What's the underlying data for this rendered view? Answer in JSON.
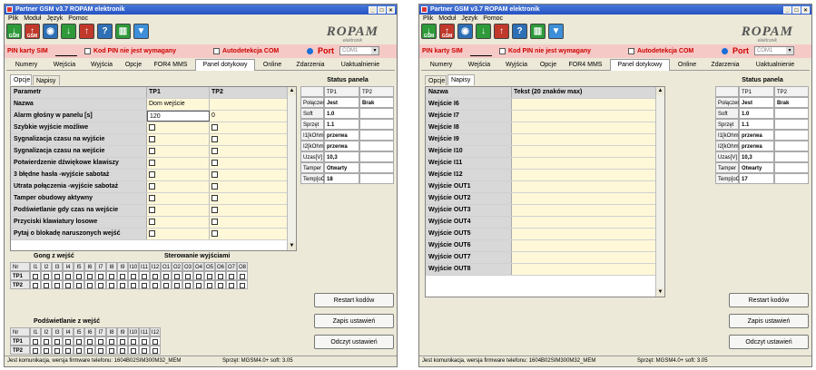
{
  "window_title": "Partner GSM v3.7 ROPAM elektronik",
  "menu": [
    "Plik",
    "Moduł",
    "Język",
    "Pomoc"
  ],
  "toolbar": {
    "buttons": [
      {
        "icon": "gsm-read-icon",
        "glyph": "↓",
        "label": "GSM",
        "color": "#2e9a3a"
      },
      {
        "icon": "gsm-write-icon",
        "glyph": "↑",
        "label": "GSM",
        "color": "#c0392b"
      },
      {
        "icon": "eye-settings-icon",
        "glyph": "◉",
        "label": "",
        "color": "#2e6fb5"
      },
      {
        "icon": "download-icon",
        "glyph": "↓",
        "label": "",
        "color": "#2e9a3a"
      },
      {
        "icon": "upload-icon",
        "glyph": "↑",
        "label": "",
        "color": "#c0392b"
      },
      {
        "icon": "help-icon",
        "glyph": "?",
        "label": "",
        "color": "#2e6fb5"
      },
      {
        "icon": "sim-card-icon",
        "glyph": "▥",
        "label": "",
        "color": "#2e9a3a"
      },
      {
        "icon": "filter-icon",
        "glyph": "▼",
        "label": "",
        "color": "#3c8fd8"
      }
    ]
  },
  "logo": {
    "text": "ROPAM",
    "sub": "elektronik"
  },
  "pin_bar": {
    "pin_label": "PIN karty SIM",
    "kod_pin_label": "Kod PIN nie jest wymagany",
    "autodetect_label": "Autodetekcja COM",
    "port_label": "Port",
    "port_value": "COM1"
  },
  "tabs": [
    "Numery",
    "Wejścia",
    "Wyjścia",
    "Opcje",
    "FOR4 MMS",
    "Panel dotykowy",
    "Online",
    "Zdarzenia",
    "Uaktualnienie"
  ],
  "selected_tab": "Panel dotykowy",
  "left_window": {
    "subtabs": [
      "Opcje",
      "Napisy"
    ],
    "grid_header": {
      "param": "Parametr",
      "tp1": "TP1",
      "tp2": "TP2"
    },
    "rows": [
      {
        "param": "Nazwa",
        "tp1": "Dom wejście",
        "tp2": ""
      },
      {
        "param": "Alarm głośny w panelu [s]",
        "tp1": "120",
        "tp2": "0"
      },
      {
        "param": "Szybkie wyjście możliwe",
        "tp1": "",
        "tp2": ""
      },
      {
        "param": "Sygnalizacja czasu na wyjście",
        "tp1": "",
        "tp2": ""
      },
      {
        "param": "Sygnalizacja czasu na wejście",
        "tp1": "",
        "tp2": ""
      },
      {
        "param": "Potwierdzenie dźwiękowe klawiszy",
        "tp1": "",
        "tp2": ""
      },
      {
        "param": "3 błędne hasła -wyjście sabotaż",
        "tp1": "",
        "tp2": ""
      },
      {
        "param": "Utrata połączenia -wyjście sabotaż",
        "tp1": "",
        "tp2": ""
      },
      {
        "param": "Tamper obudowy aktywny",
        "tp1": "",
        "tp2": ""
      },
      {
        "param": "Podświetlanie gdy czas na wejście",
        "tp1": "",
        "tp2": ""
      },
      {
        "param": "Przyciski klawiatury losowe",
        "tp1": "",
        "tp2": ""
      },
      {
        "param": "Pytaj o blokadę naruszonych wejść",
        "tp1": "",
        "tp2": ""
      }
    ],
    "gong_title": "Gong z wejść",
    "sterowanie_title": "Sterowanie wyjściami",
    "matrix1_cols": [
      "Nr",
      "I1",
      "I2",
      "I3",
      "I4",
      "I5",
      "I6",
      "I7",
      "I8",
      "I9",
      "I10",
      "I11",
      "I12",
      "O1",
      "O2",
      "O3",
      "O4",
      "O5",
      "O6",
      "O7",
      "O8"
    ],
    "matrix_rows": [
      "TP1",
      "TP2"
    ],
    "podsw_title": "Podświetlanie z wejść",
    "matrix2_cols": [
      "Nr",
      "I1",
      "I2",
      "I3",
      "I4",
      "I5",
      "I6",
      "I7",
      "I8",
      "I9",
      "I10",
      "I11",
      "I12"
    ],
    "status": {
      "title": "Status panela",
      "header": [
        "",
        "TP1",
        "TP2"
      ],
      "rows": [
        {
          "k": "Połączenie",
          "v1": "Jest",
          "v2": "Brak"
        },
        {
          "k": "Soft",
          "v1": "1.0",
          "v2": ""
        },
        {
          "k": "Sprzęt",
          "v1": "1.1",
          "v2": ""
        },
        {
          "k": "I1[kOhm]",
          "v1": "przerwa",
          "v2": ""
        },
        {
          "k": "I2[kOhm]",
          "v1": "przerwa",
          "v2": ""
        },
        {
          "k": "Uzas[V]",
          "v1": "10,3",
          "v2": ""
        },
        {
          "k": "Tamper",
          "v1": "Otwarty",
          "v2": ""
        },
        {
          "k": "Temp[oC]",
          "v1": "18",
          "v2": ""
        }
      ]
    }
  },
  "right_window": {
    "subtabs": [
      "Opcje",
      "Napisy"
    ],
    "grid_header": {
      "name": "Nazwa",
      "text": "Tekst (20 znaków max)"
    },
    "rows": [
      "Wejście I6",
      "Wejście I7",
      "Wejście I8",
      "Wejście I9",
      "Wejście I10",
      "Wejście I11",
      "Wejście I12",
      "Wyjście OUT1",
      "Wyjście OUT2",
      "Wyjście OUT3",
      "Wyjście OUT4",
      "Wyjście OUT5",
      "Wyjście OUT6",
      "Wyjście OUT7",
      "Wyjście OUT8"
    ],
    "status": {
      "title": "Status panela",
      "header": [
        "",
        "TP1",
        "TP2"
      ],
      "rows": [
        {
          "k": "Połączenie",
          "v1": "Jest",
          "v2": "Brak"
        },
        {
          "k": "Soft",
          "v1": "1.0",
          "v2": ""
        },
        {
          "k": "Sprzęt",
          "v1": "1.1",
          "v2": ""
        },
        {
          "k": "I1[kOhm]",
          "v1": "przerwa",
          "v2": ""
        },
        {
          "k": "I2[kOhm]",
          "v1": "przerwa",
          "v2": ""
        },
        {
          "k": "Uzas[V]",
          "v1": "10,3",
          "v2": ""
        },
        {
          "k": "Tamper",
          "v1": "Otwarty",
          "v2": ""
        },
        {
          "k": "Temp[oC]",
          "v1": "17",
          "v2": ""
        }
      ]
    }
  },
  "buttons": {
    "restart": "Restart kodów",
    "save": "Zapis ustawień",
    "read": "Odczyt ustawień"
  },
  "footer": {
    "left": "Jest komunikacja, wersja firmware telefonu: 1604B02SIM300M32_MEM",
    "right": "Sprzęt: MGSM4.0+ soft: 3.05"
  }
}
